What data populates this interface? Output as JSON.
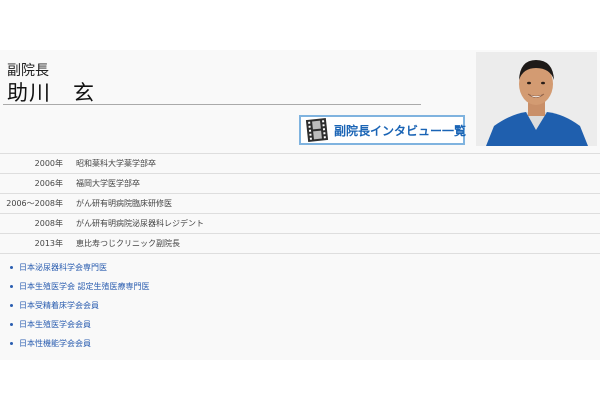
{
  "profile": {
    "role": "副院長",
    "name": "助川　玄"
  },
  "interview_button": {
    "label": "副院長インタビュー一覧",
    "icon": "film-strip-icon"
  },
  "career": [
    {
      "year": "2000年",
      "event": "昭和薬科大学薬学部卒"
    },
    {
      "year": "2006年",
      "event": "福岡大学医学部卒"
    },
    {
      "year": "2006～2008年",
      "event": "がん研有明病院臨床研修医"
    },
    {
      "year": "2008年",
      "event": "がん研有明病院泌尿器科レジデント"
    },
    {
      "year": "2013年",
      "event": "恵比寿つじクリニック副院長"
    }
  ],
  "qualifications": [
    "日本泌尿器科学会専門医",
    "日本生殖医学会 認定生殖医療専門医",
    "日本受精着床学会会員",
    "日本生殖医学会会員",
    "日本性機能学会会員"
  ],
  "colors": {
    "accent": "#1a64b5",
    "button_border": "#7fb3df",
    "panel_bg": "#f9f9f9",
    "scrub_blue": "#1f5fae"
  }
}
